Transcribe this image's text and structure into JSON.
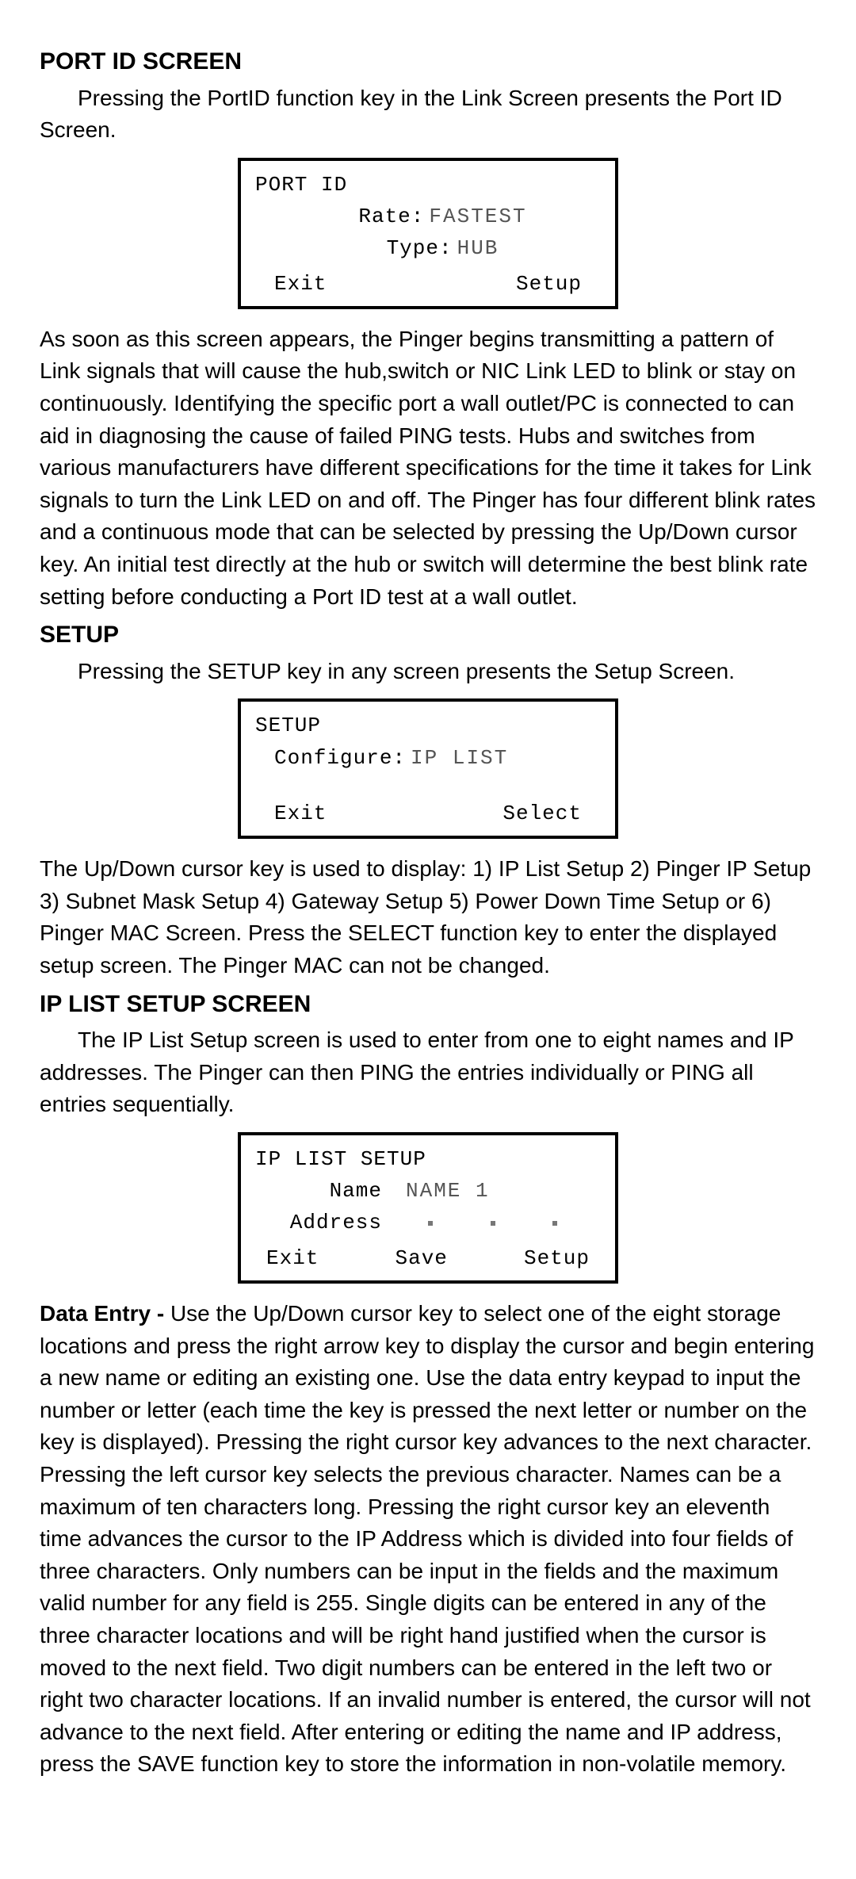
{
  "section1": {
    "heading": "PORT ID SCREEN",
    "intro": "Pressing the PortID function key in the Link Screen presents the Port ID Screen."
  },
  "lcd1": {
    "title": "PORT ID",
    "rate_label": "Rate:",
    "rate_value": "FASTEST",
    "type_label": "Type:",
    "type_value": "HUB",
    "exit": "Exit",
    "setup": "Setup"
  },
  "para1": "As soon as this screen appears, the Pinger begins transmitting a pattern of Link signals that will cause the hub,switch or NIC Link LED to blink or stay on continuously. Identifying the specific port a wall outlet/PC is connected to can aid in diagnosing the cause of failed PING tests. Hubs and switches from various manufacturers have different specifications for the time it takes for Link signals to turn the Link LED on and off. The Pinger has four different blink rates and a continuous mode that can be selected by pressing the Up/Down cursor key.  An initial test directly at the hub or switch will determine the best blink rate setting before conducting a Port ID test at a wall outlet.",
  "section2": {
    "heading": "SETUP",
    "intro": "Pressing the SETUP key in any screen presents the Setup Screen."
  },
  "lcd2": {
    "title": "SETUP",
    "configure_label": "Configure:",
    "configure_value": "IP LIST",
    "exit": "Exit",
    "select": "Select"
  },
  "para2": "The Up/Down cursor key is used to display: 1) IP List Setup 2) Pinger IP Setup 3) Subnet Mask Setup 4) Gateway Setup 5) Power Down Time Setup or 6) Pinger MAC Screen. Press the SELECT function key to enter the displayed setup screen. The Pinger MAC can not be changed.",
  "section3": {
    "heading": "IP LIST SETUP SCREEN",
    "intro": "The IP List Setup screen is used to enter from one to eight names and IP addresses. The Pinger can then PING the entries individually or PING all entries sequentially."
  },
  "lcd3": {
    "title": "IP LIST SETUP",
    "name_label": "Name",
    "name_value": "NAME 1",
    "address_label": "Address",
    "exit": "Exit",
    "save": "Save",
    "setup": "Setup"
  },
  "data_entry": {
    "bold": "Data Entry - ",
    "body": "Use the Up/Down cursor key to select one of the eight storage locations and press the right arrow key to display the cursor and begin entering a new name or editing an existing one. Use the data entry keypad to input the number or letter (each time the key is pressed the next letter or number on the key is displayed). Pressing the right cursor key advances to the next character. Pressing the left cursor key selects the previous character. Names can be a maximum of ten characters long. Pressing the right cursor key an eleventh time advances the cursor to the IP Address which is divided into four fields of three characters. Only numbers can be input in the fields and  the maximum valid number for any field is 255. Single digits can be entered in any of the three character locations and will be right hand justified when the cursor is moved to the next field. Two digit numbers can be entered in the left two or right two character locations. If an invalid number is entered, the cursor will not advance to the next field. After entering or editing the name and IP address, press the SAVE function key to store the information in non-volatile memory."
  }
}
